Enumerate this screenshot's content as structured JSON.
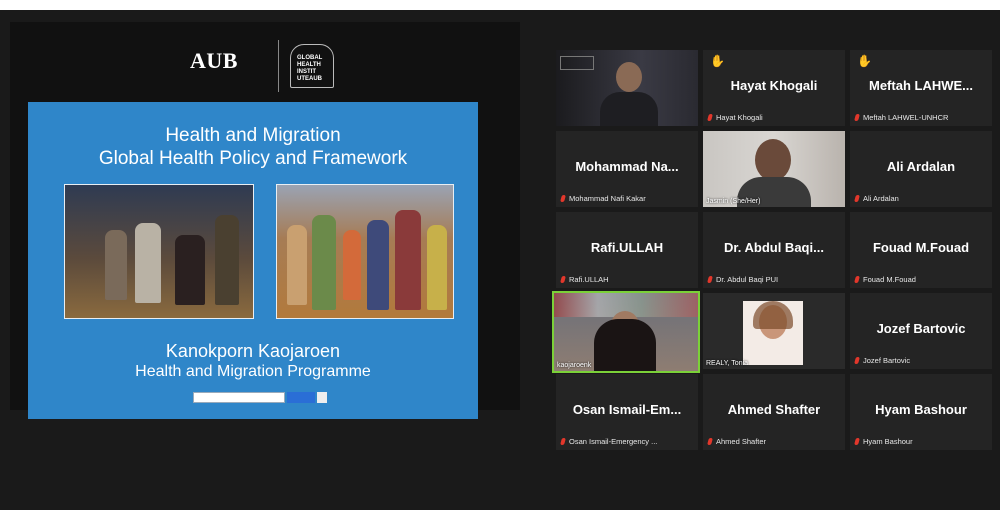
{
  "share": {
    "logo_aub": "AUB",
    "logo_ghi": "GLOBAL HEALTH INSTIT UTEAUB",
    "slide": {
      "title_line1": "Health and Migration",
      "title_line2": "Global Health Policy and Framework",
      "presenter": "Kanokporn Kaojaroen",
      "programme": "Health and Migration Programme"
    }
  },
  "tiles": [
    {
      "id": "t1",
      "video": true,
      "label": ""
    },
    {
      "id": "t2",
      "name": "Hayat Khogali",
      "label": "Hayat Khogali",
      "hand": true
    },
    {
      "id": "t3",
      "name": "Meftah LAHWE...",
      "label": "Meftah LAHWEL-UNHCR",
      "hand": true
    },
    {
      "id": "t4",
      "name": "Mohammad Na...",
      "label": "Mohammad Nafi Kakar"
    },
    {
      "id": "t5",
      "video": true,
      "label": "Jasmin (She/Her)"
    },
    {
      "id": "t6",
      "name": "Ali Ardalan",
      "label": "Ali Ardalan"
    },
    {
      "id": "t7",
      "name": "Rafi.ULLAH",
      "label": "Rafi.ULLAH"
    },
    {
      "id": "t8",
      "name": "Dr. Abdul Baqi...",
      "label": "Dr. Abdul Baqi PUI"
    },
    {
      "id": "t9",
      "name": "Fouad M.Fouad",
      "label": "Fouad M.Fouad"
    },
    {
      "id": "t10",
      "video": true,
      "label": "kaojaroenk",
      "active": true
    },
    {
      "id": "t11",
      "video": true,
      "label": "REALY, Tonia"
    },
    {
      "id": "t12",
      "name": "Jozef Bartovic",
      "label": "Jozef Bartovic"
    },
    {
      "id": "t13",
      "name": "Osan Ismail-Em...",
      "label": "Osan Ismail-Emergency ..."
    },
    {
      "id": "t14",
      "name": "Ahmed Shafter",
      "label": "Ahmed Shafter"
    },
    {
      "id": "t15",
      "name": "Hyam Bashour",
      "label": "Hyam Bashour"
    }
  ]
}
